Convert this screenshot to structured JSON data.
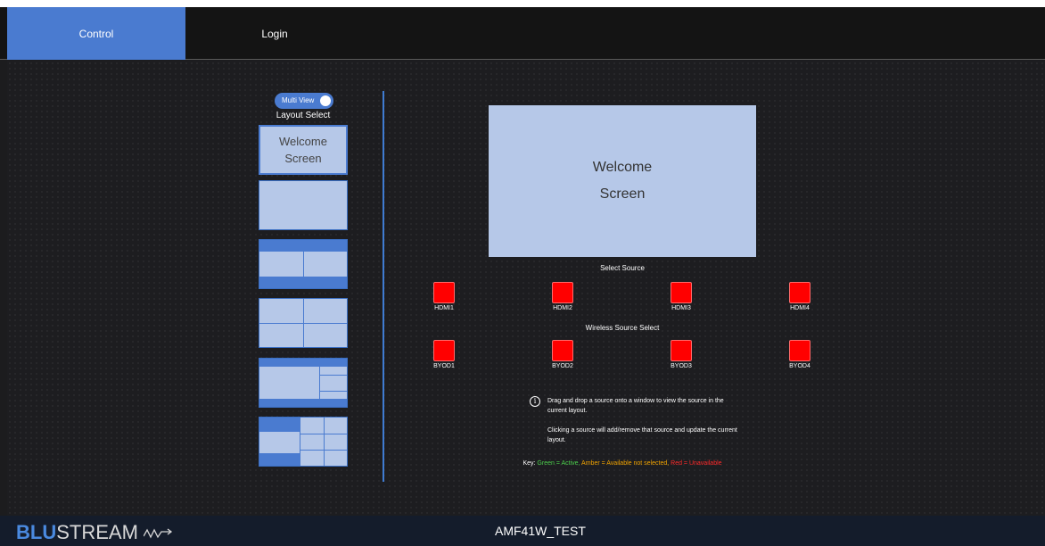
{
  "nav": {
    "control_label": "Control",
    "login_label": "Login"
  },
  "left_panel": {
    "toggle_label": "Multi View",
    "toggle_on": true,
    "layout_title": "Layout Select",
    "welcome_line1": "Welcome",
    "welcome_line2": "Screen"
  },
  "preview": {
    "line1": "Welcome",
    "line2": "Screen"
  },
  "sources": {
    "title": "Select Source",
    "items": [
      {
        "label": "HDMI1",
        "status": "unavailable"
      },
      {
        "label": "HDMI2",
        "status": "unavailable"
      },
      {
        "label": "HDMI3",
        "status": "unavailable"
      },
      {
        "label": "HDMI4",
        "status": "unavailable"
      }
    ]
  },
  "wireless": {
    "title": "Wireless Source Select",
    "items": [
      {
        "label": "BYOD1",
        "status": "unavailable"
      },
      {
        "label": "BYOD2",
        "status": "unavailable"
      },
      {
        "label": "BYOD3",
        "status": "unavailable"
      },
      {
        "label": "BYOD4",
        "status": "unavailable"
      }
    ]
  },
  "info": {
    "icon": "info-icon",
    "line1": "Drag and drop a source onto a window to view the source in the current layout.",
    "line2": "Clicking a source will add/remove that source and update the current layout."
  },
  "key": {
    "prefix": "Key:",
    "green": "Green = Active,",
    "amber": "Amber = Available not selected,",
    "red": "Red = Unavailable"
  },
  "footer": {
    "logo_blu": "BLU",
    "logo_str": "STREAM",
    "device_name": "AMF41W_TEST"
  },
  "colors": {
    "accent": "#4a7bd0",
    "unavailable": "#ff0000",
    "active": "#4cd04c",
    "available": "#f2a400"
  }
}
